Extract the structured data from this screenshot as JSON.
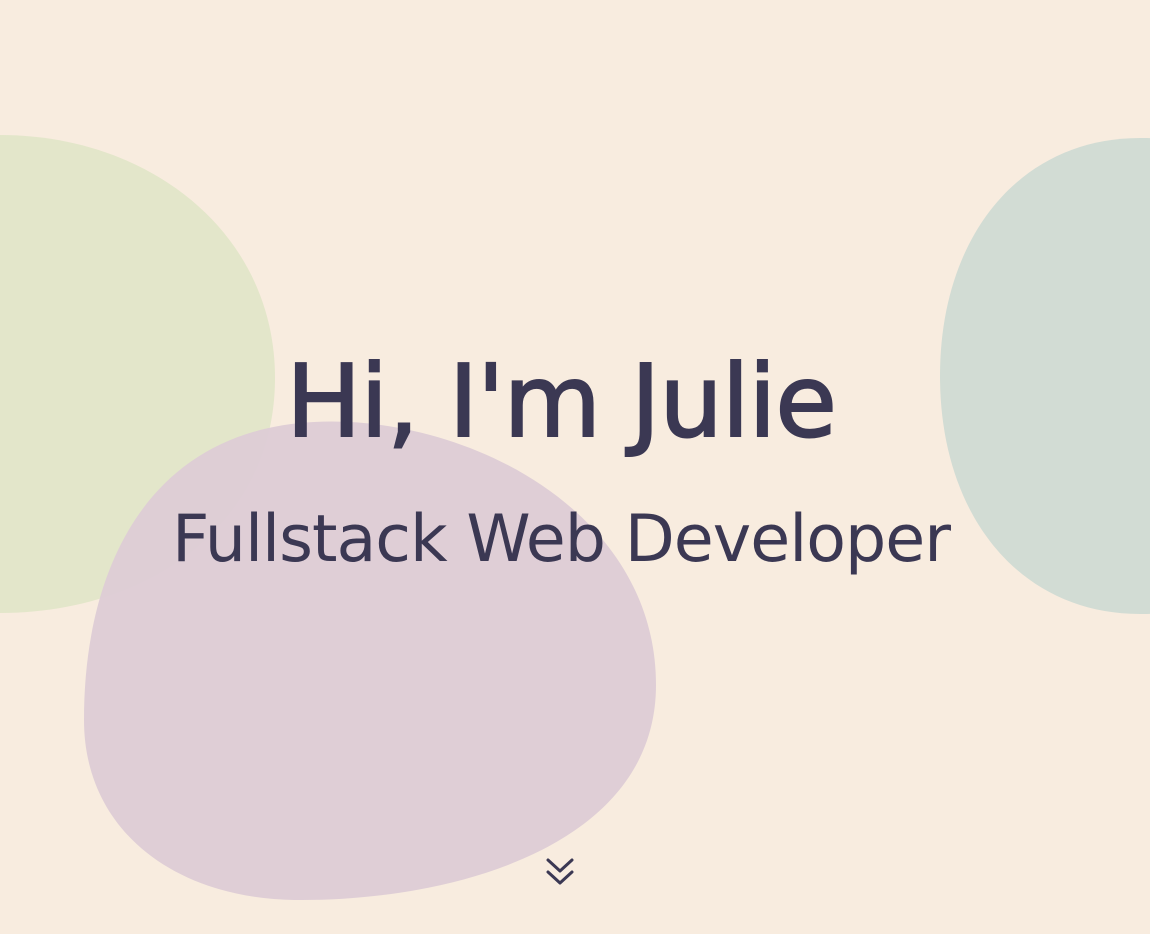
{
  "hero": {
    "greeting": "Hi, I'm Julie",
    "subtitle": "Fullstack Web Developer",
    "scroll_icon": "double-chevron-down-icon"
  },
  "colors": {
    "background": "#f8ecdf",
    "text": "#3b3853",
    "blob_green": "#e1e6c8",
    "blob_sage": "#d2dcd4",
    "blob_lilac": "#ddccd6"
  }
}
